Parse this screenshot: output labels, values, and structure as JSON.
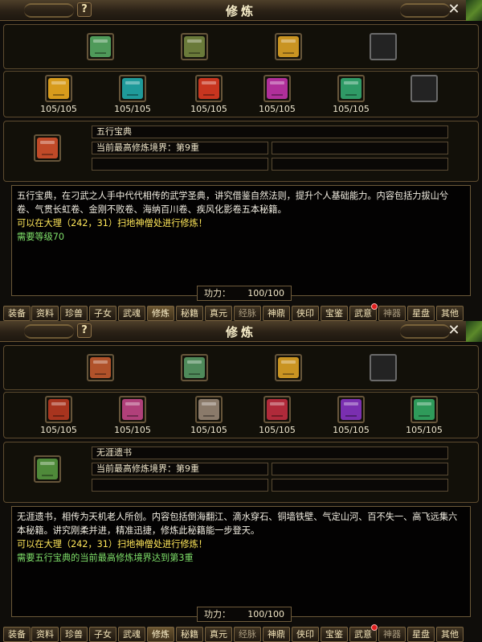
{
  "window_title": "修炼",
  "help_label": "?",
  "close_label": "✕",
  "tabs": [
    {
      "label": "装备",
      "badge": false,
      "dim": false
    },
    {
      "label": "资料",
      "badge": false,
      "dim": false
    },
    {
      "label": "珍兽",
      "badge": false,
      "dim": false
    },
    {
      "label": "子女",
      "badge": false,
      "dim": false
    },
    {
      "label": "武魂",
      "badge": false,
      "dim": false
    },
    {
      "label": "修炼",
      "badge": false,
      "dim": false
    },
    {
      "label": "秘籍",
      "badge": false,
      "dim": false
    },
    {
      "label": "真元",
      "badge": false,
      "dim": false
    },
    {
      "label": "经脉",
      "badge": false,
      "dim": true
    },
    {
      "label": "神鼎",
      "badge": false,
      "dim": false
    },
    {
      "label": "侠印",
      "badge": false,
      "dim": false
    },
    {
      "label": "宝鉴",
      "badge": false,
      "dim": false
    },
    {
      "label": "武意",
      "badge": true,
      "dim": false
    },
    {
      "label": "神器",
      "badge": false,
      "dim": true
    },
    {
      "label": "星盘",
      "badge": false,
      "dim": false
    },
    {
      "label": "其他",
      "badge": false,
      "dim": false
    }
  ],
  "panels": [
    {
      "top_books": [
        {
          "icon": "five-elements-book-icon",
          "color": "#4f9a5a",
          "empty": false
        },
        {
          "icon": "chained-scroll-icon",
          "color": "#6a7a3a",
          "empty": false
        },
        {
          "icon": "golden-scroll-icon",
          "color": "#c99422",
          "empty": false
        },
        {
          "icon": "empty-slot-icon",
          "color": "#222222",
          "empty": true
        }
      ],
      "volumes": [
        {
          "icon": "yellow-volume-icon",
          "color": "#d79b1c",
          "count": "105/105",
          "empty": false
        },
        {
          "icon": "teal-volume-icon",
          "color": "#1f9a9a",
          "count": "105/105",
          "empty": false
        },
        {
          "icon": "red-volume-icon",
          "color": "#c8351f",
          "count": "105/105",
          "empty": false
        },
        {
          "icon": "magenta-volume-icon",
          "color": "#b02f9a",
          "count": "105/105",
          "empty": false
        },
        {
          "icon": "green-volume-icon",
          "color": "#2f9a66",
          "count": "105/105",
          "empty": false
        },
        {
          "icon": "empty-slot-icon",
          "color": "#222222",
          "count": "",
          "empty": true
        }
      ],
      "selected": {
        "icon": "five-elements-book-icon",
        "color": "#c04a28",
        "name": "五行宝典",
        "realm": "当前最高修炼境界：第9重"
      },
      "desc": {
        "white": "五行宝典，在刁武之人手中代代相传的武学圣典，讲究借鉴自然法则，提升个人基础能力。内容包括力拔山兮卷、气贯长虹卷、金刚不败卷、海纳百川卷、疾风化影卷五本秘籍。",
        "yellow": "可以在大理（242，31）扫地神僧处进行修炼！",
        "green": "需要等级70"
      },
      "power": {
        "label": "功力：",
        "value": "100/100"
      }
    },
    {
      "top_books": [
        {
          "icon": "five-elements-book-icon",
          "color": "#b0522a",
          "empty": false
        },
        {
          "icon": "chained-scroll-icon",
          "color": "#4f8a5a",
          "empty": false
        },
        {
          "icon": "golden-scroll-icon",
          "color": "#c99422",
          "empty": false
        },
        {
          "icon": "empty-slot-icon",
          "color": "#222222",
          "empty": true
        }
      ],
      "volumes": [
        {
          "icon": "red-scroll-icon",
          "color": "#a8341e",
          "count": "105/105",
          "empty": false
        },
        {
          "icon": "pink-scroll-icon",
          "color": "#b0407a",
          "count": "105/105",
          "empty": false
        },
        {
          "icon": "grey-scroll-icon",
          "color": "#8a7a6a",
          "count": "105/105",
          "empty": false
        },
        {
          "icon": "crimson-scroll-icon",
          "color": "#b02a3a",
          "count": "105/105",
          "empty": false
        },
        {
          "icon": "purple-scroll-icon",
          "color": "#7a2fb0",
          "count": "105/105",
          "empty": false
        },
        {
          "icon": "emerald-scroll-icon",
          "color": "#2f9a5a",
          "count": "105/105",
          "empty": false
        }
      ],
      "selected": {
        "icon": "chained-scroll-icon",
        "color": "#4f8a3a",
        "name": "无涯遗书",
        "realm": "当前最高修炼境界：第9重"
      },
      "desc": {
        "white": "无涯遗书，相传为天机老人所创。内容包括倒海翻江、滴水穿石、铜墙铁壁、气定山河、百不失一、高飞远集六本秘籍。讲究刚柔并进，精准迅捷，修炼此秘籍能一步登天。",
        "yellow": "可以在大理（242，31）扫地神僧处进行修炼！",
        "green": "需要五行宝典的当前最高修炼境界达到第3重"
      },
      "power": {
        "label": "功力：",
        "value": "100/100"
      }
    }
  ]
}
